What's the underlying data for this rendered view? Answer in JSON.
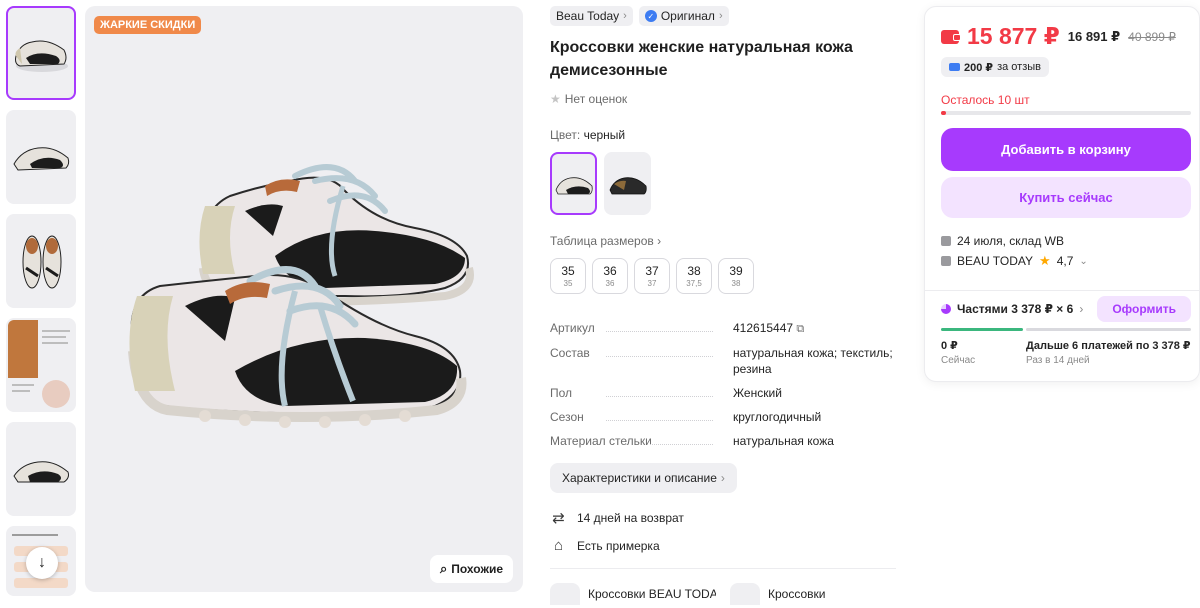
{
  "gallery": {
    "promo_badge": "ЖАРКИЕ СКИДКИ",
    "similar_label": "Похожие"
  },
  "product": {
    "brand": "Beau Today",
    "original_label": "Оригинал",
    "title": "Кроссовки женские натуральная кожа демисезонные",
    "rating_text": "Нет оценок",
    "color_label": "Цвет:",
    "color_value": "черный",
    "sizes_title": "Таблица размеров",
    "sizes": [
      {
        "size": "35",
        "ru": "35"
      },
      {
        "size": "36",
        "ru": "36"
      },
      {
        "size": "37",
        "ru": "37"
      },
      {
        "size": "38",
        "ru": "37,5"
      },
      {
        "size": "39",
        "ru": "38"
      }
    ],
    "specs": [
      {
        "key": "Артикул",
        "value": "412615447"
      },
      {
        "key": "Состав",
        "value": "натуральная кожа; текстиль; резина"
      },
      {
        "key": "Пол",
        "value": "Женский"
      },
      {
        "key": "Сезон",
        "value": "круглогодичный"
      },
      {
        "key": "Материал стельки",
        "value": "натуральная кожа"
      }
    ],
    "details_button": "Характеристики и описание",
    "return_text": "14 дней на возврат",
    "fitting_text": "Есть примерка",
    "categories": [
      "Кроссовки BEAU TODA",
      "Кроссовки"
    ]
  },
  "buy_card": {
    "price": "15 877 ₽",
    "price_alt": "16 891 ₽",
    "price_old": "40 899 ₽",
    "review_bonus": "200 ₽",
    "review_bonus_suffix": "за отзыв",
    "stock_text": "Осталось 10 шт",
    "stock_fraction": 0.01,
    "add_to_cart": "Добавить в корзину",
    "buy_now": "Купить сейчас",
    "delivery": "24 июля, склад WB",
    "seller": "BEAU TODAY",
    "seller_rating": "4,7",
    "installments_label": "Частями 3 378 ₽ × 6",
    "order_button": "Оформить",
    "pay_now_amount": "0 ₽",
    "pay_now_sub": "Сейчас",
    "pay_later_amount": "Дальше 6 платежей по 3 378 ₽",
    "pay_later_sub": "Раз в 14 дней"
  },
  "colors": {
    "accent": "#a73afd",
    "price": "#f23a46",
    "promo": "#f0894a"
  }
}
